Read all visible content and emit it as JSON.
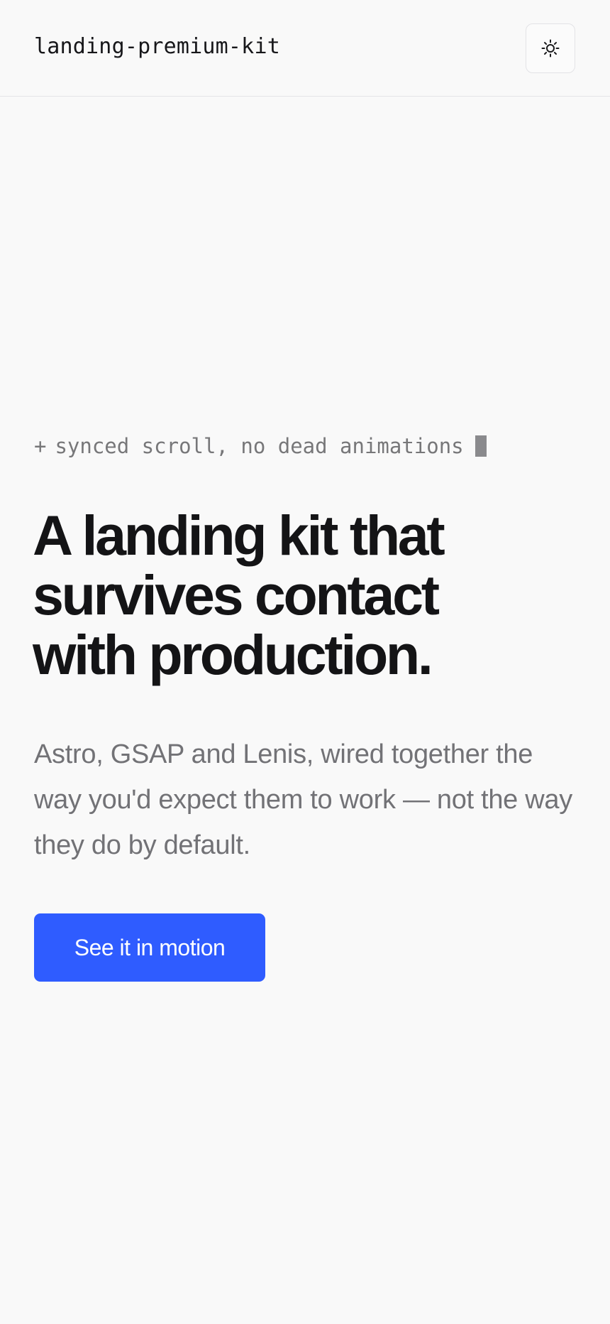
{
  "header": {
    "brand": "landing-premium-kit",
    "theme_toggle_icon": "sun-icon"
  },
  "hero": {
    "eyebrow_prefix": "+",
    "eyebrow_text": "synced scroll, no dead animations",
    "headline_lines": [
      "A landing kit that",
      "survives contact",
      "with production."
    ],
    "subtext": "Astro, GSAP and Lenis, wired together the way you'd expect them to work — not the way they do by default.",
    "cta_label": "See it in motion"
  },
  "colors": {
    "background": "#f9f9f9",
    "primary_text": "#141416",
    "muted_text": "#727276",
    "accent": "#2f5cff"
  }
}
